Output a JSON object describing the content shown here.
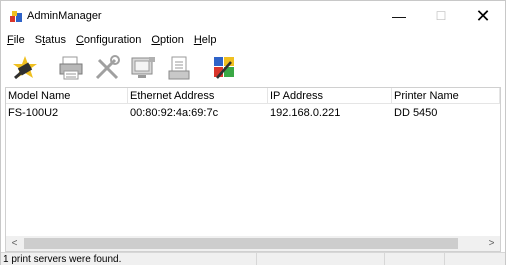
{
  "window": {
    "title": "AdminManager",
    "minimize": "—",
    "maximize": "☐",
    "close": "✕"
  },
  "menu": [
    {
      "pre": "",
      "acc": "F",
      "post": "ile"
    },
    {
      "pre": "S",
      "acc": "t",
      "post": "atus"
    },
    {
      "pre": "",
      "acc": "C",
      "post": "onfiguration"
    },
    {
      "pre": "",
      "acc": "O",
      "post": "ption"
    },
    {
      "pre": "",
      "acc": "H",
      "post": "elp"
    }
  ],
  "toolbar": {
    "icons": [
      "search-printer-icon",
      "printer-status-icon",
      "tools-icon",
      "monitor-icon",
      "document-icon",
      "web-config-icon"
    ]
  },
  "list": {
    "columns": [
      "Model Name",
      "Ethernet Address",
      "IP Address",
      "Printer Name"
    ],
    "rows": [
      {
        "model": "FS-100U2",
        "ethernet": "00:80:92:4a:69:7c",
        "ip": "192.168.0.221",
        "printer": "DD 5450"
      }
    ]
  },
  "scroll": {
    "left": "<",
    "right": ">"
  },
  "status": {
    "message": "1 print servers were found."
  },
  "colors": {
    "accent": "#f0c020",
    "icon_dark": "#303030",
    "icon_gray": "#9a9a9a"
  }
}
